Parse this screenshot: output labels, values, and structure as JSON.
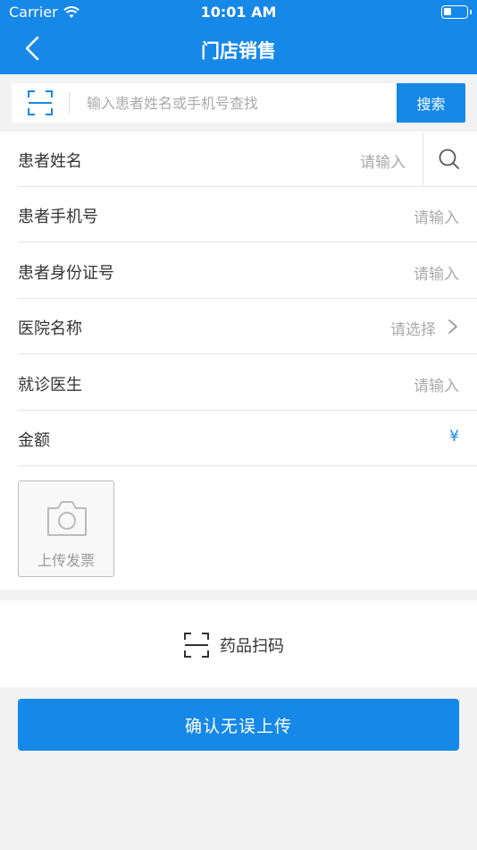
{
  "status": {
    "carrier": "Carrier",
    "time": "10:01 AM"
  },
  "nav": {
    "title": "门店销售"
  },
  "search": {
    "placeholder": "输入患者姓名或手机号查找",
    "button": "搜索"
  },
  "form": {
    "rows": [
      {
        "label": "患者姓名",
        "value": "请输入"
      },
      {
        "label": "患者手机号",
        "value": "请输入"
      },
      {
        "label": "患者身份证号",
        "value": "请输入"
      },
      {
        "label": "医院名称",
        "value": "请选择"
      },
      {
        "label": "就诊医生",
        "value": "请输入"
      },
      {
        "label": "金额",
        "value": "¥"
      }
    ],
    "upload_label": "上传发票"
  },
  "scan": {
    "label": "药品扫码"
  },
  "confirm": {
    "label": "确认无误上传"
  },
  "colors": {
    "primary": "#1688e8",
    "background": "#f2f2f2",
    "placeholder": "#aaaaaa"
  }
}
